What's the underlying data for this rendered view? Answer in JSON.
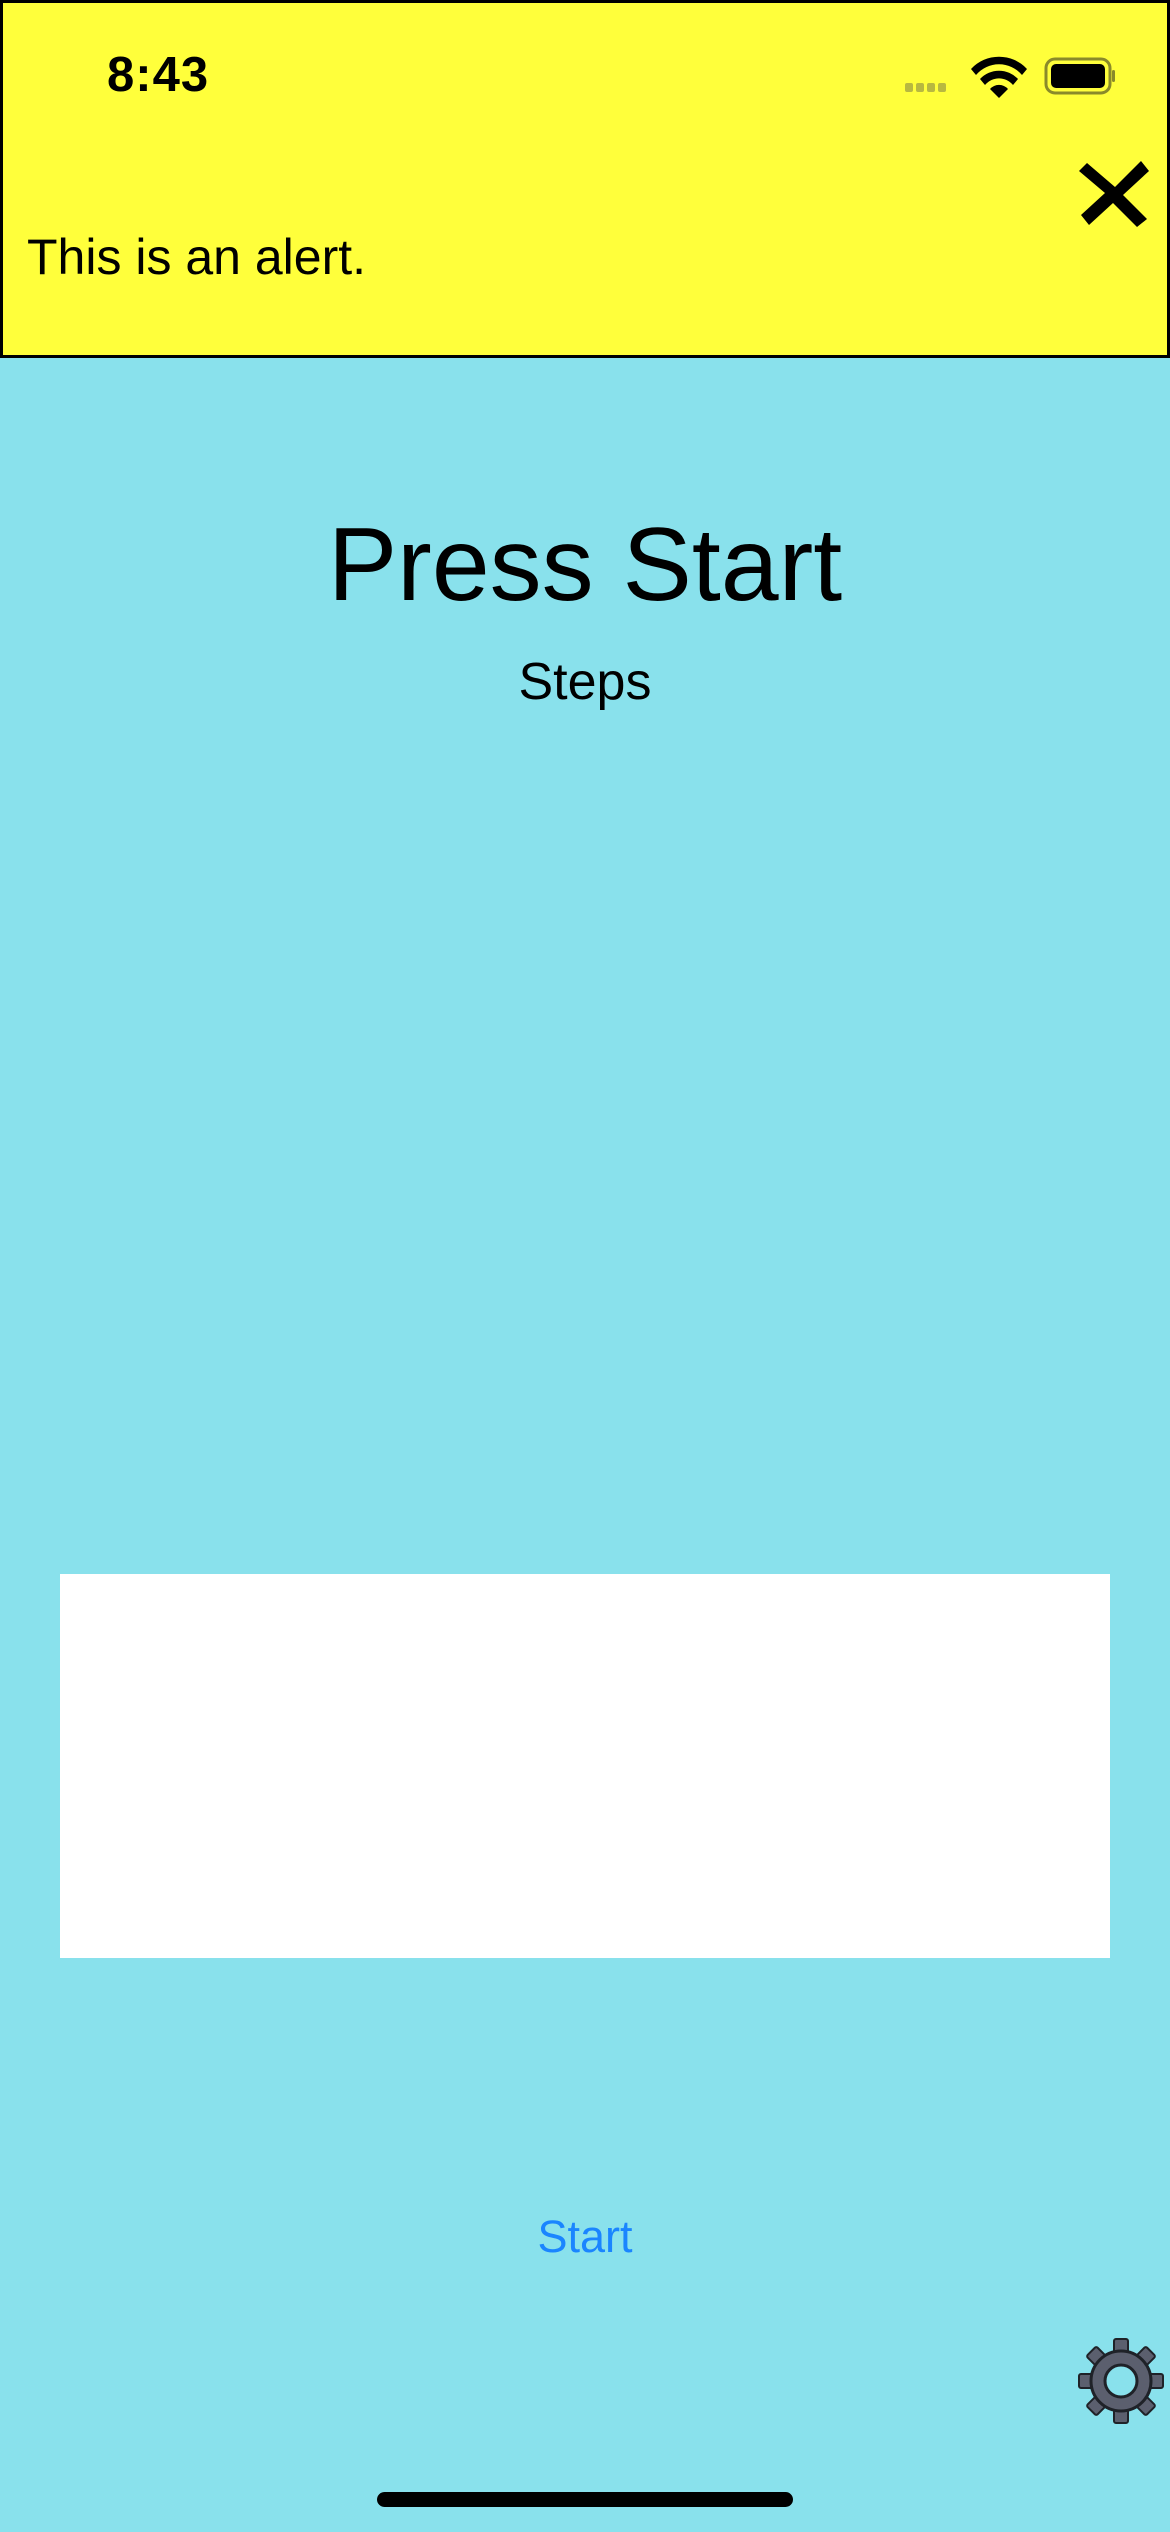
{
  "status_bar": {
    "time": "8:43"
  },
  "alert": {
    "message": "This is an alert.",
    "background_color": "#ffff3b",
    "close_icon": "close-x-icon"
  },
  "main": {
    "title": "Press Start",
    "subtitle": "Steps",
    "background_color": "#89e1ec"
  },
  "actions": {
    "start_label": "Start",
    "start_color": "#1a85ff",
    "settings_icon": "gear-icon"
  }
}
